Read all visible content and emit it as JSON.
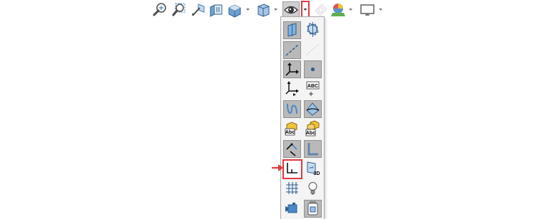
{
  "toolbar": {
    "tools": [
      {
        "name": "zoom-to-fit-icon"
      },
      {
        "name": "zoom-to-area-icon"
      },
      {
        "name": "previous-view-icon"
      },
      {
        "name": "section-view-icon"
      },
      {
        "name": "view-orientation-icon",
        "has_dropdown": true
      },
      {
        "name": "display-style-icon",
        "has_dropdown": true
      },
      {
        "name": "hide-show-items-icon",
        "has_dropdown": true,
        "dropdown_open": true
      },
      {
        "name": "edit-appearance-icon",
        "disabled": true
      },
      {
        "name": "apply-scene-icon",
        "has_dropdown": true
      },
      {
        "name": "view-settings-icon",
        "has_dropdown": true
      }
    ]
  },
  "flyout": {
    "rows": [
      {
        "left": {
          "name": "view-planes-icon",
          "active": true
        },
        "right": {
          "name": "view-all-planes-icon",
          "active": false
        }
      },
      {
        "left": {
          "name": "view-axes-icon",
          "active": true
        },
        "right": {
          "name": "view-temporary-axes-icon",
          "active": false,
          "disabled": true
        }
      },
      {
        "left": {
          "name": "view-origins-icon",
          "active": true
        },
        "right": {
          "name": "view-points-icon",
          "active": true
        }
      },
      {
        "left": {
          "name": "view-coordinate-systems-icon",
          "active": false
        },
        "right": {
          "name": "view-dimension-names-icon",
          "active": false
        }
      },
      {
        "left": {
          "name": "view-curves-icon",
          "active": true
        },
        "right": {
          "name": "view-parting-lines-icon",
          "active": true
        }
      },
      {
        "left": {
          "name": "view-annotations-icon",
          "active": false
        },
        "right": {
          "name": "view-all-annotations-icon",
          "active": false
        }
      },
      {
        "left": {
          "name": "view-sketch-relations-icon",
          "active": true
        },
        "right": {
          "name": "view-weld-beads-icon",
          "active": true
        }
      },
      {
        "left": {
          "name": "view-sketches-icon",
          "active": false,
          "highlighted": true
        },
        "right": {
          "name": "view-3d-sketch-planes-icon",
          "active": false
        }
      },
      {
        "left": {
          "name": "view-grid-icon",
          "active": false
        },
        "right": {
          "name": "view-lights-icon",
          "active": false
        }
      },
      {
        "left": {
          "name": "view-cameras-icon",
          "active": false
        },
        "right": {
          "name": "view-decals-icon",
          "active": true
        }
      }
    ],
    "text_glyphs": {
      "dimension_names": "ABC",
      "annotations": "Abc",
      "all_annotations": "Abc",
      "sketch_3d_planes": "3D"
    }
  },
  "colors": {
    "highlight": "#e0393d",
    "icon_blue": "#3f7fb8",
    "active_cell": "#b9b9b9"
  }
}
